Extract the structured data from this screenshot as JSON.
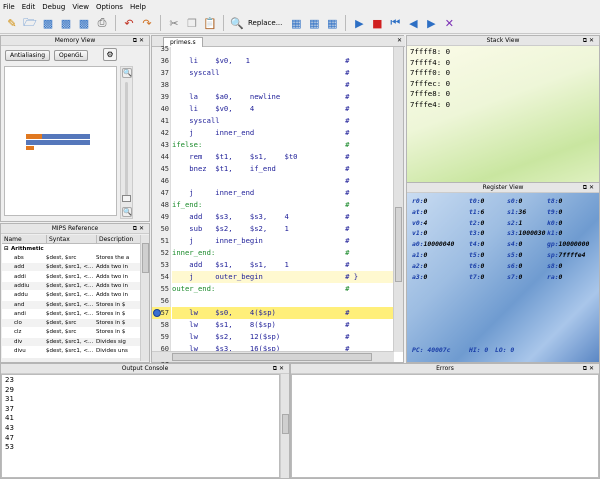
{
  "menu": [
    "File",
    "Edit",
    "Debug",
    "View",
    "Options",
    "Help"
  ],
  "toolbar": {
    "replace_label": "Replace..."
  },
  "memory": {
    "title": "Memory View",
    "btn_antialiasing": "Antialiasing",
    "btn_opengl": "OpenGL"
  },
  "mips": {
    "title": "MIPS Reference",
    "col_name": "Name",
    "col_syntax": "Syntax",
    "col_desc": "Description",
    "group": "Arithmetic",
    "rows": [
      [
        "abs",
        "$dest, $src",
        "Stores the a"
      ],
      [
        "add",
        "$dest, $src1, <...",
        "Adds two in"
      ],
      [
        "addi",
        "$dest, $src1, <...",
        "Adds two in"
      ],
      [
        "addiu",
        "$dest, $src1, <...",
        "Adds two in"
      ],
      [
        "addu",
        "$dest, $src1, <...",
        "Adds two in"
      ],
      [
        "and",
        "$dest, $src1, <...",
        "Stores in $"
      ],
      [
        "andi",
        "$dest, $src1, <...",
        "Stores in $"
      ],
      [
        "clo",
        "$dest, $src",
        "Stores in $"
      ],
      [
        "clz",
        "$dest, $src",
        "Stores in $"
      ],
      [
        "div",
        "$dest, $src1, <...",
        "Divides sig"
      ],
      [
        "divu",
        "$dest, $src1, <...",
        "Divides uns"
      ]
    ]
  },
  "editor": {
    "tab": "primes.s",
    "first_line": 35,
    "lines": [
      {
        "n": 35,
        "code": ""
      },
      {
        "n": 36,
        "code": "    li    $v0,   1                      #"
      },
      {
        "n": 37,
        "code": "    syscall                             #"
      },
      {
        "n": 38,
        "code": "                                        #"
      },
      {
        "n": 39,
        "code": "    la    $a0,    newline               #"
      },
      {
        "n": 40,
        "code": "    li    $v0,    4                     #"
      },
      {
        "n": 41,
        "code": "    syscall                             #"
      },
      {
        "n": 42,
        "code": "    j     inner_end                     #"
      },
      {
        "n": 43,
        "code": "ifelse:                                 #"
      },
      {
        "n": 44,
        "code": "    rem   $t1,    $s1,    $t0           #"
      },
      {
        "n": 45,
        "code": "    bnez  $t1,    if_end                #"
      },
      {
        "n": 46,
        "code": "                                        #"
      },
      {
        "n": 47,
        "code": "    j     inner_end                     #"
      },
      {
        "n": 48,
        "code": "if_end:                                 #"
      },
      {
        "n": 49,
        "code": "    add   $s3,    $s3,    4             #"
      },
      {
        "n": 50,
        "code": "    sub   $s2,    $s2,    1             #"
      },
      {
        "n": 51,
        "code": "    j     inner_begin                   #"
      },
      {
        "n": 52,
        "code": "inner_end:                              #"
      },
      {
        "n": 53,
        "code": "    add   $s1,    $s1,    1             #"
      },
      {
        "n": 54,
        "code": "    j     outer_begin                   # }"
      },
      {
        "n": 55,
        "code": "outer_end:                              #"
      },
      {
        "n": 56,
        "code": ""
      },
      {
        "n": 57,
        "code": "    lw    $s0,    4($sp)                #"
      },
      {
        "n": 58,
        "code": "    lw    $s1,    8($sp)                #"
      },
      {
        "n": 59,
        "code": "    lw    $s2,    12($sp)               #"
      },
      {
        "n": 60,
        "code": "    lw    $s3,    16($sp)               #"
      },
      {
        "n": 61,
        "code": "    lw    $ra,    20($sp)               #"
      },
      {
        "n": 62,
        "code": "    add   $sp,    $sp,    20            #"
      },
      {
        "n": 63,
        "code": "    jr    $ra                           # retu"
      },
      {
        "n": 64,
        "code": ""
      },
      {
        "n": 65,
        "code": ""
      }
    ]
  },
  "stack": {
    "title": "Stack View",
    "rows": [
      "7ffff8: 0",
      "7ffff4: 0",
      "7ffff0: 0",
      "7fffec: 0",
      "7fffe8: 0",
      "7fffe4: 0"
    ]
  },
  "registers": {
    "title": "Register View",
    "cols": [
      [
        [
          "r0:",
          "0"
        ],
        [
          "at:",
          "0"
        ],
        [
          "v0:",
          "4"
        ],
        [
          "v1:",
          "0"
        ],
        [
          "a0:",
          "10000040"
        ],
        [
          "a1:",
          "0"
        ],
        [
          "a2:",
          "0"
        ],
        [
          "a3:",
          "0"
        ]
      ],
      [
        [
          "t0:",
          "0"
        ],
        [
          "t1:",
          "6"
        ],
        [
          "t2:",
          "0"
        ],
        [
          "t3:",
          "0"
        ],
        [
          "t4:",
          "0"
        ],
        [
          "t5:",
          "0"
        ],
        [
          "t6:",
          "0"
        ],
        [
          "t7:",
          "0"
        ]
      ],
      [
        [
          "s0:",
          "0"
        ],
        [
          "s1:",
          "36"
        ],
        [
          "s2:",
          "1"
        ],
        [
          "s3:",
          "1000030"
        ],
        [
          "s4:",
          "0"
        ],
        [
          "s5:",
          "0"
        ],
        [
          "s6:",
          "0"
        ],
        [
          "s7:",
          "0"
        ]
      ],
      [
        [
          "t8:",
          "0"
        ],
        [
          "t9:",
          "0"
        ],
        [
          "k0:",
          "0"
        ],
        [
          "k1:",
          "0"
        ],
        [
          "gp:",
          "10000000"
        ],
        [
          "sp:",
          "7ffffe4"
        ],
        [
          "s8:",
          "0"
        ],
        [
          "ra:",
          "0"
        ]
      ]
    ],
    "pc": "PC: 40007c",
    "hi": "HI: 0",
    "lo": "LO: 0"
  },
  "console": {
    "title": "Output Console",
    "lines": [
      "23",
      "29",
      "31",
      "37",
      "41",
      "43",
      "47",
      "53"
    ]
  },
  "errors": {
    "title": "Errors"
  }
}
